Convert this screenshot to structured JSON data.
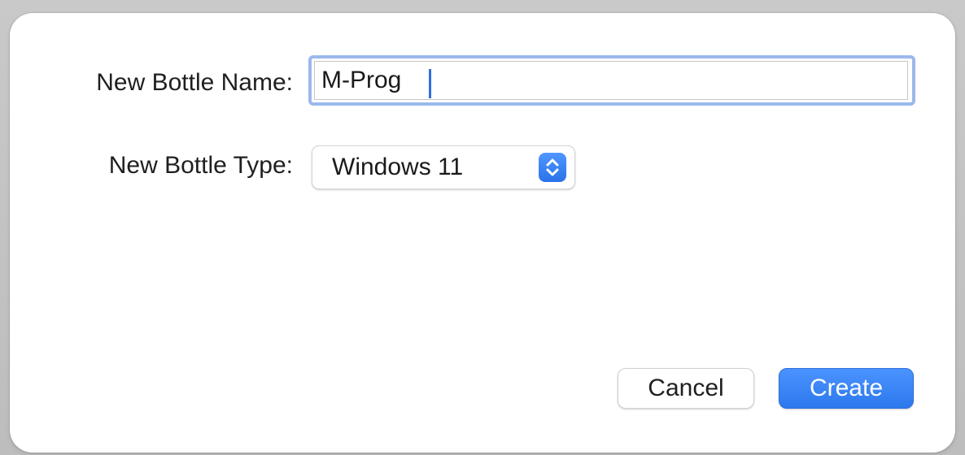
{
  "dialog": {
    "name_label": "New Bottle Name:",
    "name_value": "M-Prog",
    "type_label": "New Bottle Type:",
    "type_value": "Windows 11",
    "type_icon": "chevron-up-down-icon",
    "cancel_label": "Cancel",
    "create_label": "Create"
  },
  "colors": {
    "accent": "#2d78ec",
    "focus_ring": "#9bb8ec",
    "background": "#ffffff",
    "backdrop": "#bdbdbd"
  }
}
